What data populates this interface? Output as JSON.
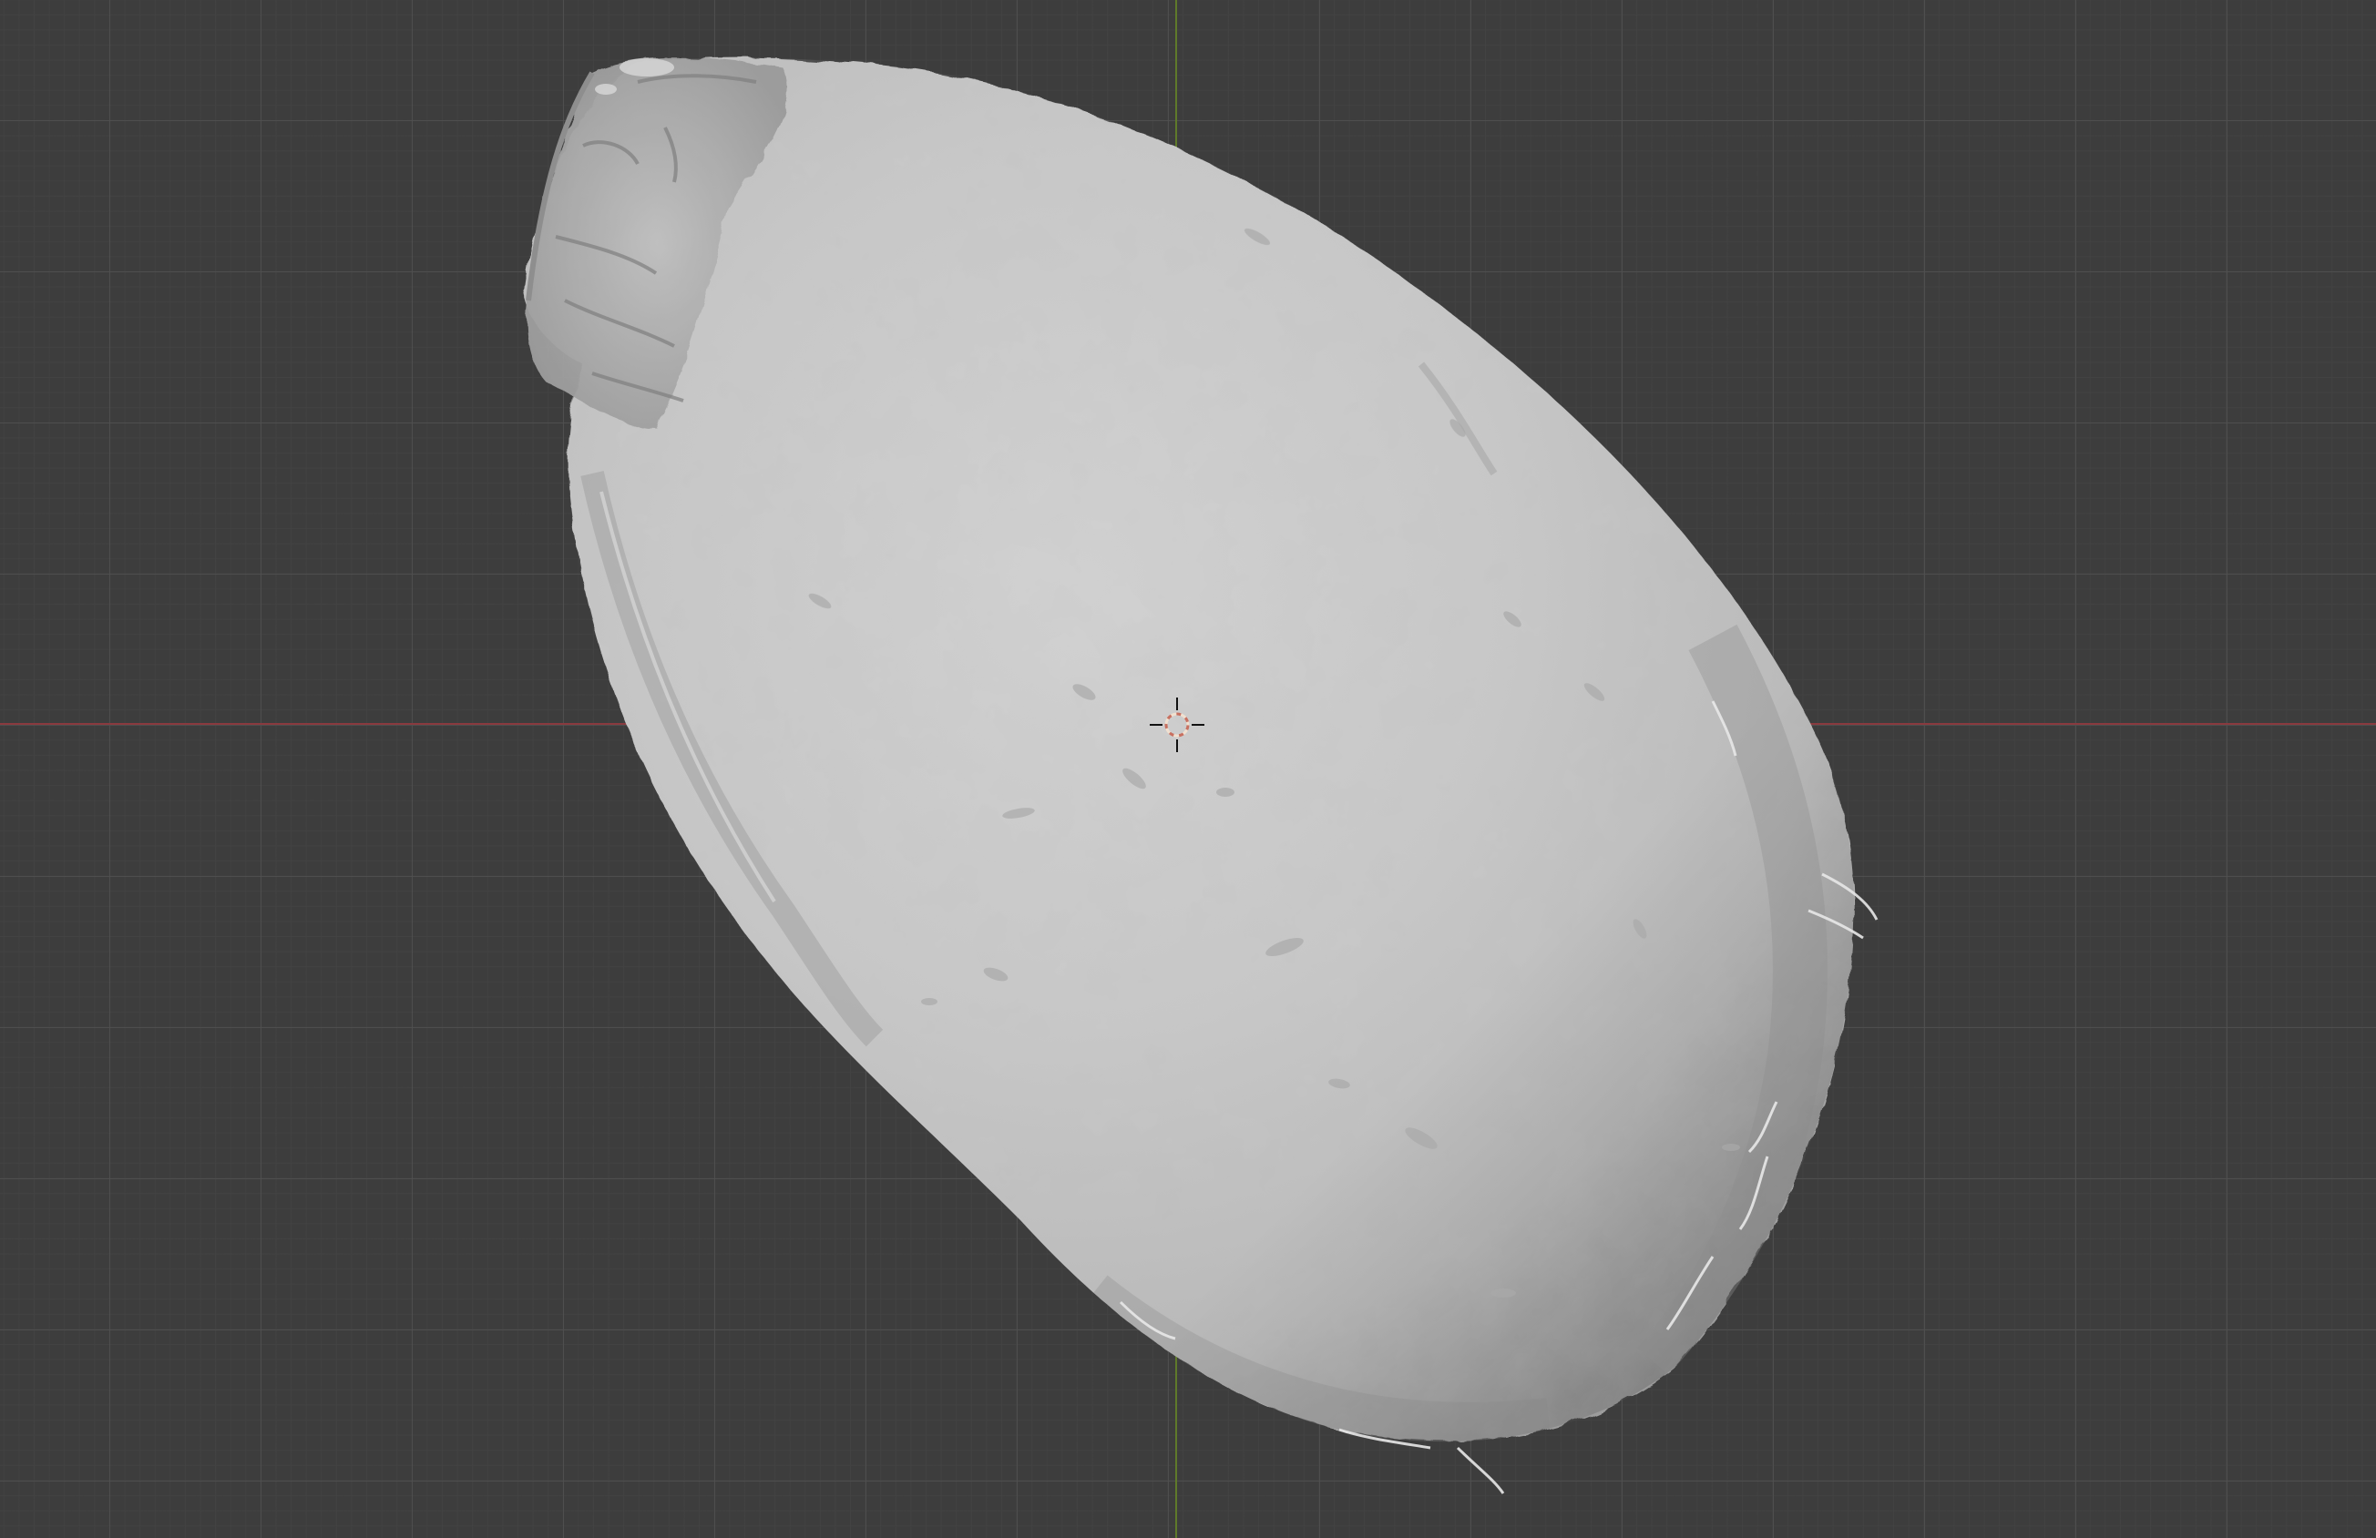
{
  "viewport": {
    "grid_color": "#505050",
    "background_color": "#3d3d3d",
    "x_axis_color": "#8a3a3f",
    "y_axis_color": "#5f7a2a"
  },
  "object": {
    "shape": "egg-shaped-scanned-mesh",
    "shading": "solid",
    "color": "#c9c9c9"
  },
  "cursor": {
    "icon": "3d-cursor-icon"
  }
}
